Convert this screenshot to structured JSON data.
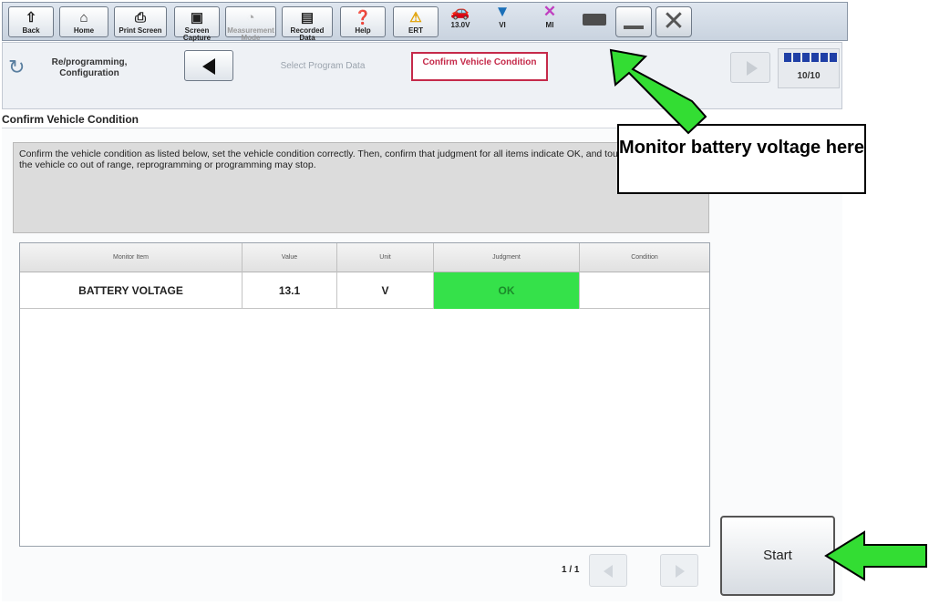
{
  "toolbar": {
    "buttons": [
      {
        "label": "Back",
        "icon": "back-arrow-icon"
      },
      {
        "label": "Home",
        "icon": "home-icon"
      },
      {
        "label": "Print Screen",
        "icon": "printer-icon"
      },
      {
        "label": "Screen Capture",
        "icon": "camera-icon"
      },
      {
        "label": "Measurement Mode",
        "icon": "meter-icon"
      },
      {
        "label": "Recorded Data",
        "icon": "folder-icon"
      },
      {
        "label": "Help",
        "icon": "help-icon"
      },
      {
        "label": "ERT",
        "icon": "warning-icon"
      }
    ],
    "status": {
      "battery_voltage": "13.0V",
      "vi_label": "VI",
      "mi_label": "MI"
    }
  },
  "nav": {
    "section_label": "Re/programming, Configuration",
    "step_prev": "Select Program Data",
    "step_current": "Confirm Vehicle Condition",
    "progress": "10/10"
  },
  "page": {
    "title": "Confirm Vehicle Condition",
    "instructions": "Confirm the vehicle condition as listed below, set the vehicle condition correctly. Then, confirm that judgment for all items indicate OK, and touch \"Start\". In case the vehicle co out of range, reprogramming or programming may stop."
  },
  "table": {
    "headers": [
      "Monitor Item",
      "Value",
      "Unit",
      "Judgment",
      "Condition"
    ],
    "rows": [
      {
        "item": "BATTERY VOLTAGE",
        "value": "13.1",
        "unit": "V",
        "judgment": "OK",
        "condition": ""
      }
    ],
    "page_indicator": "1 / 1"
  },
  "start_label": "Start",
  "annotation": {
    "callout_text": "Monitor battery voltage here",
    "arrow_color": "#33dd33"
  }
}
